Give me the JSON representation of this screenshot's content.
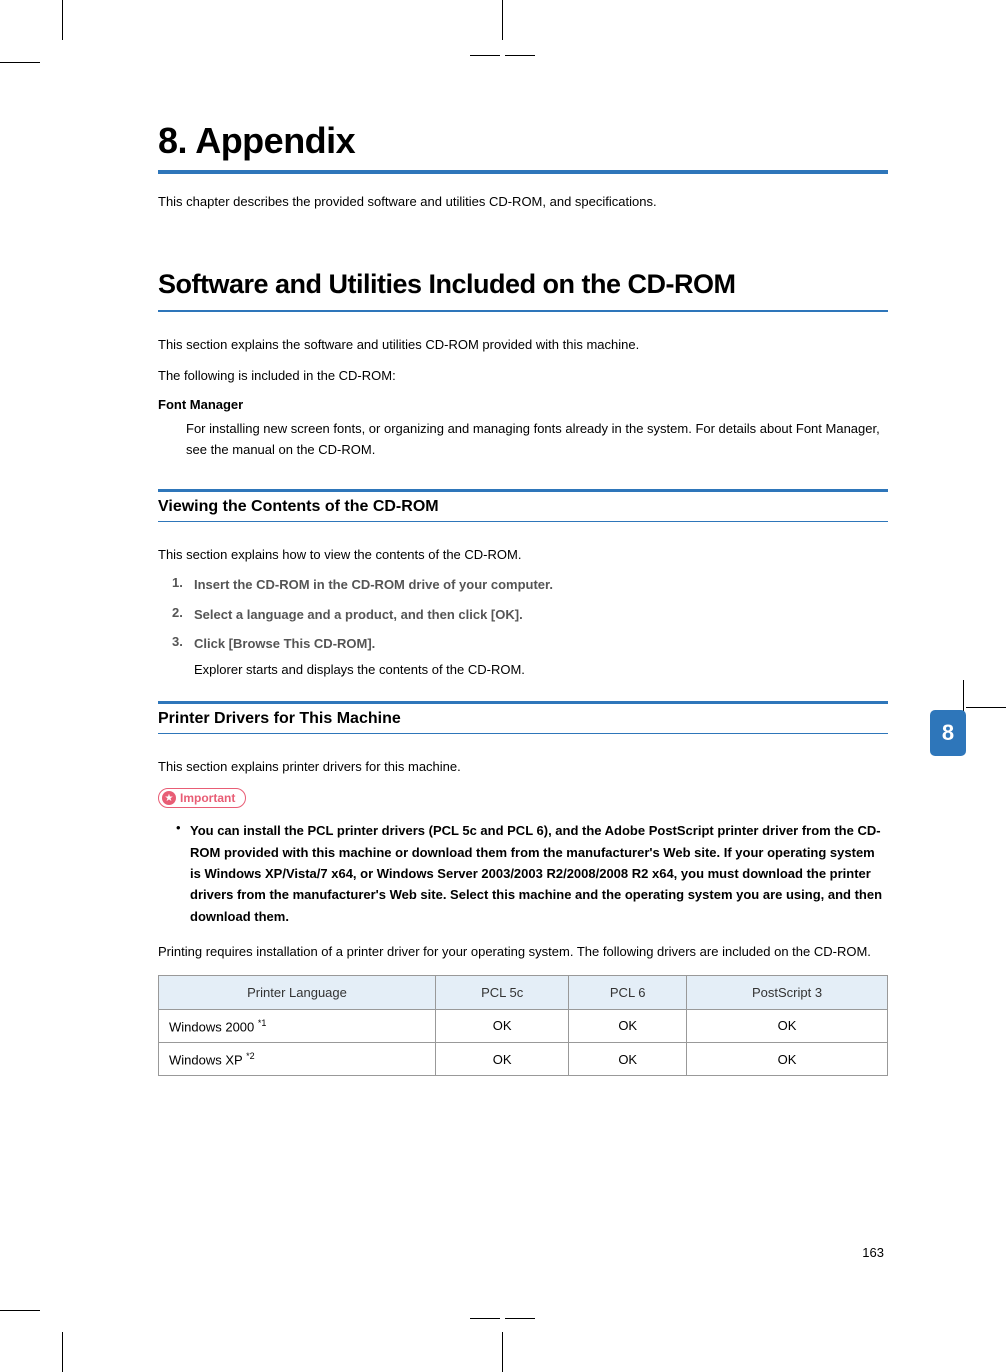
{
  "chapter": {
    "title": "8. Appendix",
    "desc": "This chapter describes the provided software and utilities CD-ROM, and specifications."
  },
  "section": {
    "title": "Software and Utilities Included on the CD-ROM",
    "intro1": "This section explains the software and utilities CD-ROM provided with this machine.",
    "intro2": "The following is included in the CD-ROM:",
    "font_manager_head": "Font Manager",
    "font_manager_body": "For installing new screen fonts, or organizing and managing fonts already in the system. For details about Font Manager, see the manual on the CD-ROM."
  },
  "sub1": {
    "title": "Viewing the Contents of the CD-ROM",
    "intro": "This section explains how to view the contents of the CD-ROM.",
    "steps": [
      {
        "num": "1.",
        "txt": "Insert the CD-ROM in the CD-ROM drive of your computer."
      },
      {
        "num": "2.",
        "txt": "Select a language and a product, and then click [OK]."
      },
      {
        "num": "3.",
        "txt": "Click [Browse This CD-ROM].",
        "sub": "Explorer starts and displays the contents of the CD-ROM."
      }
    ]
  },
  "sub2": {
    "title": "Printer Drivers for This Machine",
    "intro": "This section explains printer drivers for this machine.",
    "important_label": "Important",
    "bullet": "You can install the PCL printer drivers (PCL 5c and PCL 6), and the Adobe PostScript printer driver from the CD-ROM provided with this machine or download them from the manufacturer's Web site. If your operating system is Windows XP/Vista/7 x64, or Windows Server 2003/2003 R2/2008/2008 R2 x64, you must download the printer drivers from the manufacturer's Web site. Select this machine and the operating system you are using, and then download them.",
    "after": "Printing requires installation of a printer driver for your operating system. The following drivers are included on the CD-ROM."
  },
  "table": {
    "headers": [
      "Printer Language",
      "PCL 5c",
      "PCL 6",
      "PostScript 3"
    ],
    "rows": [
      {
        "name": "Windows 2000 ",
        "sup": "*1",
        "c1": "OK",
        "c2": "OK",
        "c3": "OK"
      },
      {
        "name": "Windows XP ",
        "sup": "*2",
        "c1": "OK",
        "c2": "OK",
        "c3": "OK"
      }
    ]
  },
  "tab_num": "8",
  "page_num": "163"
}
